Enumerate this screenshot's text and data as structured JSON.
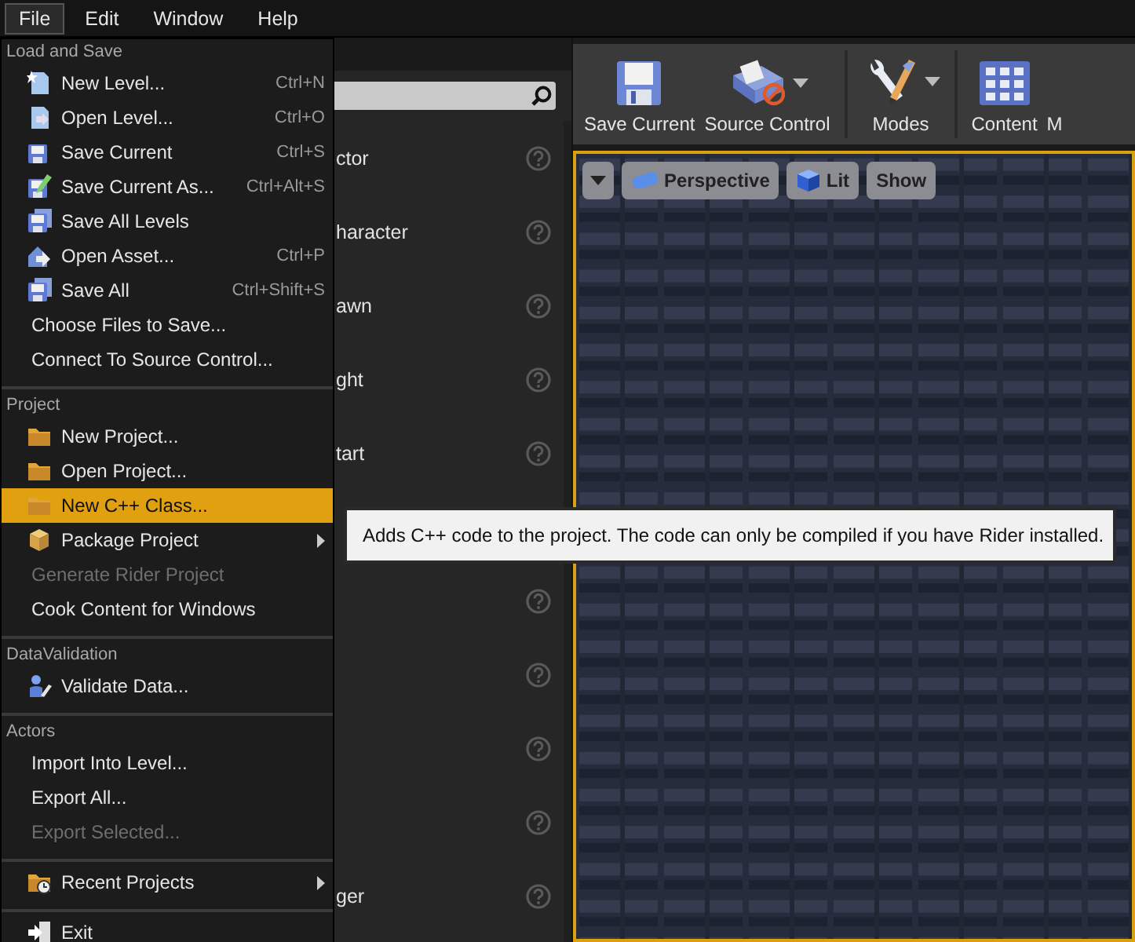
{
  "menu_bar": [
    {
      "label": "File",
      "selected": true
    },
    {
      "label": "Edit",
      "selected": false
    },
    {
      "label": "Window",
      "selected": false
    },
    {
      "label": "Help",
      "selected": false
    }
  ],
  "file_menu": [
    {
      "header": "Load and Save",
      "items": [
        {
          "label": "New Level...",
          "shortcut": "Ctrl+N",
          "disabled": false,
          "selected": false,
          "submenu": false
        },
        {
          "label": "Open Level...",
          "shortcut": "Ctrl+O",
          "disabled": false,
          "selected": false,
          "submenu": false
        },
        {
          "label": "Save Current",
          "shortcut": "Ctrl+S",
          "disabled": false,
          "selected": false,
          "submenu": false
        },
        {
          "label": "Save Current As...",
          "shortcut": "Ctrl+Alt+S",
          "disabled": false,
          "selected": false,
          "submenu": false
        },
        {
          "label": "Save All Levels",
          "disabled": false,
          "selected": false,
          "submenu": false
        },
        {
          "label": "Open Asset...",
          "shortcut": "Ctrl+P",
          "disabled": false,
          "selected": false,
          "submenu": false
        },
        {
          "label": "Save All",
          "shortcut": "Ctrl+Shift+S",
          "disabled": false,
          "selected": false,
          "submenu": false
        },
        {
          "label": "Choose Files to Save...",
          "disabled": false,
          "selected": false,
          "submenu": false
        },
        {
          "label": "Connect To Source Control...",
          "disabled": false,
          "selected": false,
          "submenu": false
        }
      ]
    },
    {
      "header": "Project",
      "items": [
        {
          "label": "New Project...",
          "disabled": false,
          "selected": false,
          "submenu": false
        },
        {
          "label": "Open Project...",
          "disabled": false,
          "selected": false,
          "submenu": false
        },
        {
          "label": "New C++ Class...",
          "disabled": false,
          "selected": true,
          "submenu": false
        },
        {
          "label": "Package Project",
          "disabled": false,
          "selected": false,
          "submenu": true
        },
        {
          "label": "Generate Rider Project",
          "disabled": true,
          "selected": false,
          "submenu": false
        },
        {
          "label": "Cook Content for Windows",
          "disabled": false,
          "selected": false,
          "submenu": false
        }
      ]
    },
    {
      "header": "DataValidation",
      "items": [
        {
          "label": "Validate Data...",
          "disabled": false,
          "selected": false,
          "submenu": false
        }
      ]
    },
    {
      "header": "Actors",
      "items": [
        {
          "label": "Import Into Level...",
          "disabled": false,
          "selected": false,
          "submenu": false
        },
        {
          "label": "Export All...",
          "disabled": false,
          "selected": false,
          "submenu": false
        },
        {
          "label": "Export Selected...",
          "disabled": true,
          "selected": false,
          "submenu": false
        }
      ]
    },
    {
      "items": [
        {
          "label": "Recent Projects",
          "disabled": false,
          "selected": false,
          "submenu": true
        }
      ]
    },
    {
      "items": [
        {
          "label": "Exit",
          "disabled": false,
          "selected": false,
          "submenu": false
        }
      ]
    }
  ],
  "tooltip": "Adds C++ code to the project. The code can only be compiled if you have Rider installed.",
  "place_actors": [
    {
      "kind": "named",
      "label": "ctor"
    },
    {
      "kind": "named",
      "label": "haracter"
    },
    {
      "kind": "named",
      "label": "awn"
    },
    {
      "kind": "named",
      "label": "ght"
    },
    {
      "kind": "named",
      "label": "tart"
    },
    {
      "kind": "covered"
    },
    {
      "kind": "blank"
    },
    {
      "kind": "blank"
    },
    {
      "kind": "blank"
    },
    {
      "kind": "blank"
    },
    {
      "kind": "named",
      "label": "ger"
    }
  ],
  "toolbar": [
    {
      "label": "Save Current",
      "dropdown": false
    },
    {
      "label": "Source Control",
      "dropdown": true
    },
    {
      "label": "Modes",
      "dropdown": true
    },
    {
      "label": "Content",
      "dropdown": false
    },
    {
      "label": "M",
      "dropdown": false
    }
  ],
  "viewport_toolbar": [
    {
      "label": "Perspective"
    },
    {
      "label": "Lit"
    },
    {
      "label": "Show"
    }
  ]
}
